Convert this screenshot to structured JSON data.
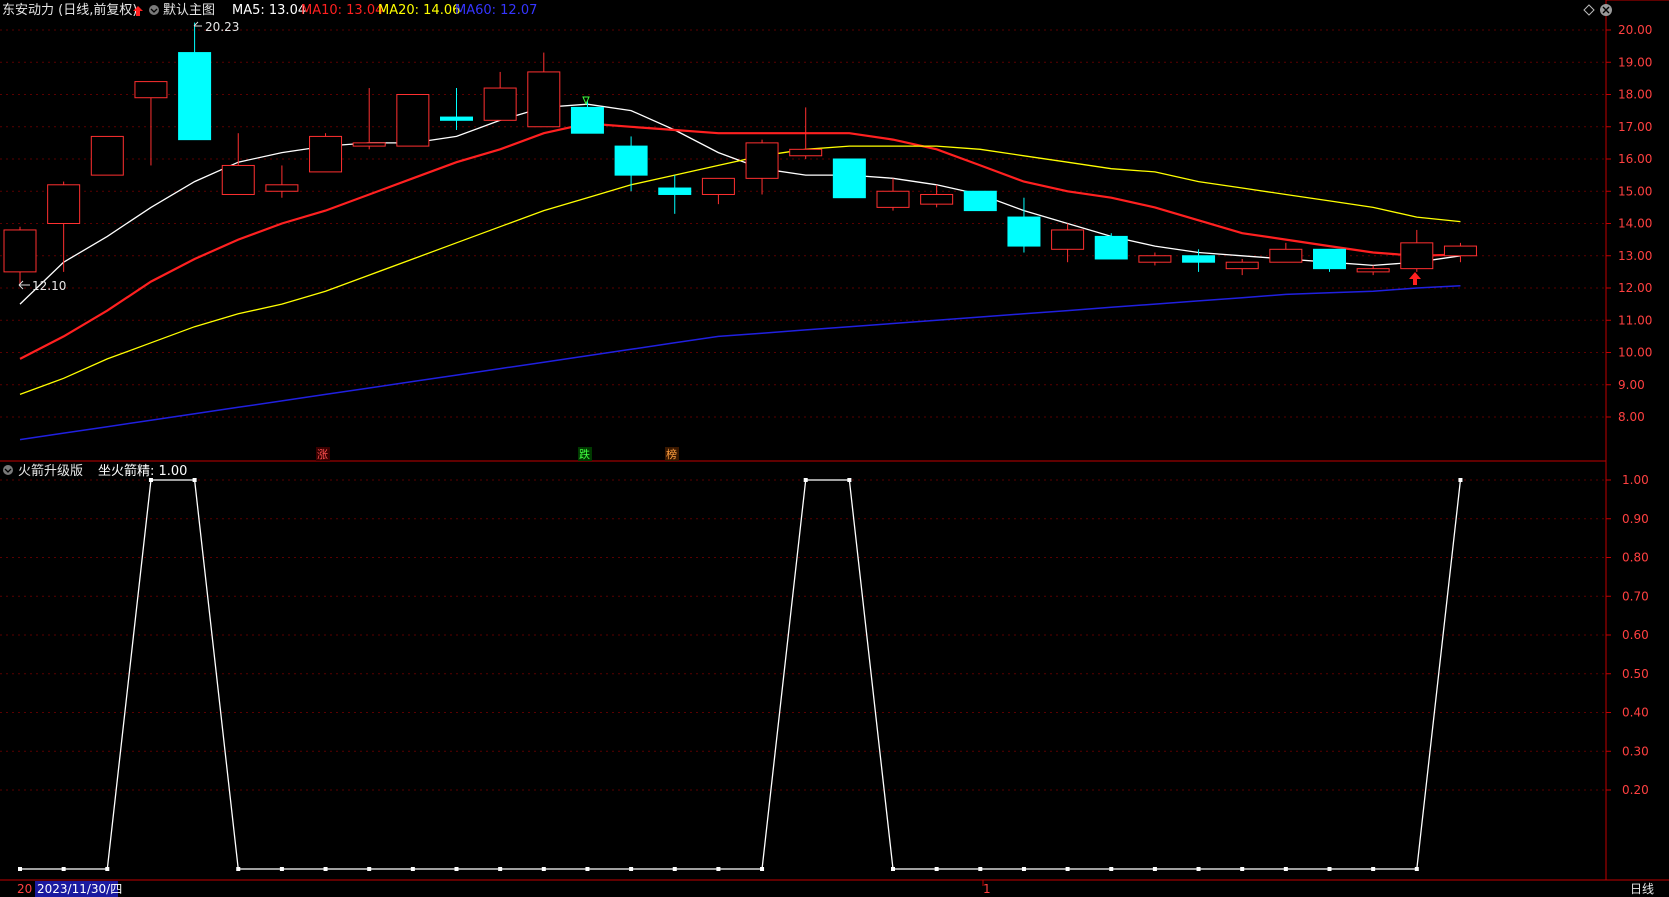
{
  "header": {
    "stock_title": "东安动力 (日线,前复权)",
    "main_chart_name": "默认主图",
    "ma": [
      {
        "label": "MA5: 13.04",
        "color": "#ffffff"
      },
      {
        "label": "MA10: 13.04",
        "color": "#ff2020"
      },
      {
        "label": "MA20: 14.06",
        "color": "#ffff00"
      },
      {
        "label": "MA60: 12.07",
        "color": "#3535ff"
      }
    ]
  },
  "indicator": {
    "name": "火箭升级版",
    "value_label": "坐火箭精: 1.00"
  },
  "annotations": {
    "high_label": "20.23",
    "low_label": "12.10",
    "marker_zhang": "涨",
    "marker_die": "跌",
    "marker_bang": "榜"
  },
  "footer": {
    "left_code": "20",
    "date_label": "2023/11/30/四",
    "mid_label": "1",
    "period_label": "日线"
  },
  "colors": {
    "up": "#ff3030",
    "down": "#00ffff",
    "ma5": "#ffffff",
    "ma10": "#ff2020",
    "ma20": "#ffff00",
    "ma60": "#2020e0",
    "axis": "#c00000",
    "grid": "#5a0000"
  },
  "chart_data": [
    {
      "type": "candlestick",
      "title": "东安动力 (日线,前复权)",
      "y_ticks": [
        "20.00",
        "19.00",
        "18.00",
        "17.00",
        "16.00",
        "15.00",
        "14.00",
        "13.00",
        "12.00",
        "11.00",
        "10.00",
        "9.00",
        "8.00"
      ],
      "ylim": [
        7.3,
        20.6
      ],
      "candles": [
        {
          "o": 12.5,
          "h": 13.9,
          "l": 12.1,
          "c": 13.8
        },
        {
          "o": 14.0,
          "h": 15.3,
          "l": 12.5,
          "c": 15.2
        },
        {
          "o": 15.5,
          "h": 16.7,
          "l": 15.5,
          "c": 16.7
        },
        {
          "o": 17.9,
          "h": 18.4,
          "l": 15.8,
          "c": 18.4
        },
        {
          "o": 19.3,
          "h": 20.23,
          "l": 16.6,
          "c": 16.6
        },
        {
          "o": 14.9,
          "h": 16.8,
          "l": 14.9,
          "c": 15.8
        },
        {
          "o": 15.0,
          "h": 15.8,
          "l": 14.8,
          "c": 15.2
        },
        {
          "o": 15.6,
          "h": 16.8,
          "l": 15.6,
          "c": 16.7
        },
        {
          "o": 16.4,
          "h": 18.2,
          "l": 16.3,
          "c": 16.5
        },
        {
          "o": 16.4,
          "h": 18.0,
          "l": 16.4,
          "c": 18.0
        },
        {
          "o": 17.3,
          "h": 18.2,
          "l": 16.9,
          "c": 17.2
        },
        {
          "o": 17.2,
          "h": 18.7,
          "l": 17.2,
          "c": 18.2
        },
        {
          "o": 17.0,
          "h": 19.3,
          "l": 17.0,
          "c": 18.7
        },
        {
          "o": 17.6,
          "h": 17.8,
          "l": 16.8,
          "c": 16.8
        },
        {
          "o": 16.4,
          "h": 16.7,
          "l": 15.0,
          "c": 15.5
        },
        {
          "o": 15.1,
          "h": 15.5,
          "l": 14.3,
          "c": 14.9
        },
        {
          "o": 14.9,
          "h": 15.4,
          "l": 14.6,
          "c": 15.4
        },
        {
          "o": 15.4,
          "h": 16.6,
          "l": 14.9,
          "c": 16.5
        },
        {
          "o": 16.1,
          "h": 17.6,
          "l": 16.0,
          "c": 16.3
        },
        {
          "o": 16.0,
          "h": 16.0,
          "l": 14.8,
          "c": 14.8
        },
        {
          "o": 14.5,
          "h": 15.4,
          "l": 14.4,
          "c": 15.0
        },
        {
          "o": 14.6,
          "h": 15.2,
          "l": 14.5,
          "c": 14.9
        },
        {
          "o": 15.0,
          "h": 15.0,
          "l": 14.4,
          "c": 14.4
        },
        {
          "o": 14.2,
          "h": 14.8,
          "l": 13.1,
          "c": 13.3
        },
        {
          "o": 13.2,
          "h": 14.0,
          "l": 12.8,
          "c": 13.8
        },
        {
          "o": 13.6,
          "h": 13.7,
          "l": 12.9,
          "c": 12.9
        },
        {
          "o": 12.8,
          "h": 13.1,
          "l": 12.7,
          "c": 13.0
        },
        {
          "o": 13.0,
          "h": 13.2,
          "l": 12.5,
          "c": 12.8
        },
        {
          "o": 12.6,
          "h": 12.9,
          "l": 12.4,
          "c": 12.8
        },
        {
          "o": 12.8,
          "h": 13.4,
          "l": 12.8,
          "c": 13.2
        },
        {
          "o": 13.2,
          "h": 13.2,
          "l": 12.5,
          "c": 12.6
        },
        {
          "o": 12.5,
          "h": 12.7,
          "l": 12.4,
          "c": 12.6
        },
        {
          "o": 12.6,
          "h": 13.8,
          "l": 12.5,
          "c": 13.4
        },
        {
          "o": 13.0,
          "h": 13.4,
          "l": 12.8,
          "c": 13.3
        }
      ],
      "series": [
        {
          "name": "MA5",
          "values": [
            11.5,
            12.8,
            13.6,
            14.5,
            15.3,
            15.9,
            16.2,
            16.4,
            16.5,
            16.5,
            16.7,
            17.2,
            17.6,
            17.7,
            17.5,
            16.9,
            16.2,
            15.7,
            15.5,
            15.5,
            15.4,
            15.2,
            14.9,
            14.4,
            14.0,
            13.6,
            13.3,
            13.1,
            13.0,
            12.9,
            12.8,
            12.7,
            12.8,
            13.0
          ]
        },
        {
          "name": "MA10",
          "values": [
            9.8,
            10.5,
            11.3,
            12.2,
            12.9,
            13.5,
            14.0,
            14.4,
            14.9,
            15.4,
            15.9,
            16.3,
            16.8,
            17.1,
            17.0,
            16.9,
            16.8,
            16.8,
            16.8,
            16.8,
            16.6,
            16.3,
            15.8,
            15.3,
            15.0,
            14.8,
            14.5,
            14.1,
            13.7,
            13.5,
            13.3,
            13.1,
            13.0,
            13.04
          ]
        },
        {
          "name": "MA20",
          "values": [
            8.7,
            9.2,
            9.8,
            10.3,
            10.8,
            11.2,
            11.5,
            11.9,
            12.4,
            12.9,
            13.4,
            13.9,
            14.4,
            14.8,
            15.2,
            15.5,
            15.8,
            16.1,
            16.3,
            16.4,
            16.4,
            16.4,
            16.3,
            16.1,
            15.9,
            15.7,
            15.6,
            15.3,
            15.1,
            14.9,
            14.7,
            14.5,
            14.2,
            14.06
          ]
        },
        {
          "name": "MA60",
          "values": [
            7.3,
            7.5,
            7.7,
            7.9,
            8.1,
            8.3,
            8.5,
            8.7,
            8.9,
            9.1,
            9.3,
            9.5,
            9.7,
            9.9,
            10.1,
            10.3,
            10.5,
            10.6,
            10.7,
            10.8,
            10.9,
            11.0,
            11.1,
            11.2,
            11.3,
            11.4,
            11.5,
            11.6,
            11.7,
            11.8,
            11.85,
            11.9,
            12.0,
            12.07
          ]
        }
      ]
    },
    {
      "type": "line",
      "title": "火箭升级版",
      "y_ticks": [
        "1.00",
        "0.90",
        "0.80",
        "0.70",
        "0.60",
        "0.50",
        "0.40",
        "0.30",
        "0.20"
      ],
      "ylim": [
        0,
        1.05
      ],
      "series": [
        {
          "name": "坐火箭精",
          "values": [
            0,
            0,
            0,
            1,
            1,
            0,
            0,
            0,
            0,
            0,
            0,
            0,
            0,
            0,
            0,
            0,
            0,
            0,
            1,
            1,
            0,
            0,
            0,
            0,
            0,
            0,
            0,
            0,
            0,
            0,
            0,
            0,
            0,
            1
          ]
        }
      ]
    }
  ]
}
